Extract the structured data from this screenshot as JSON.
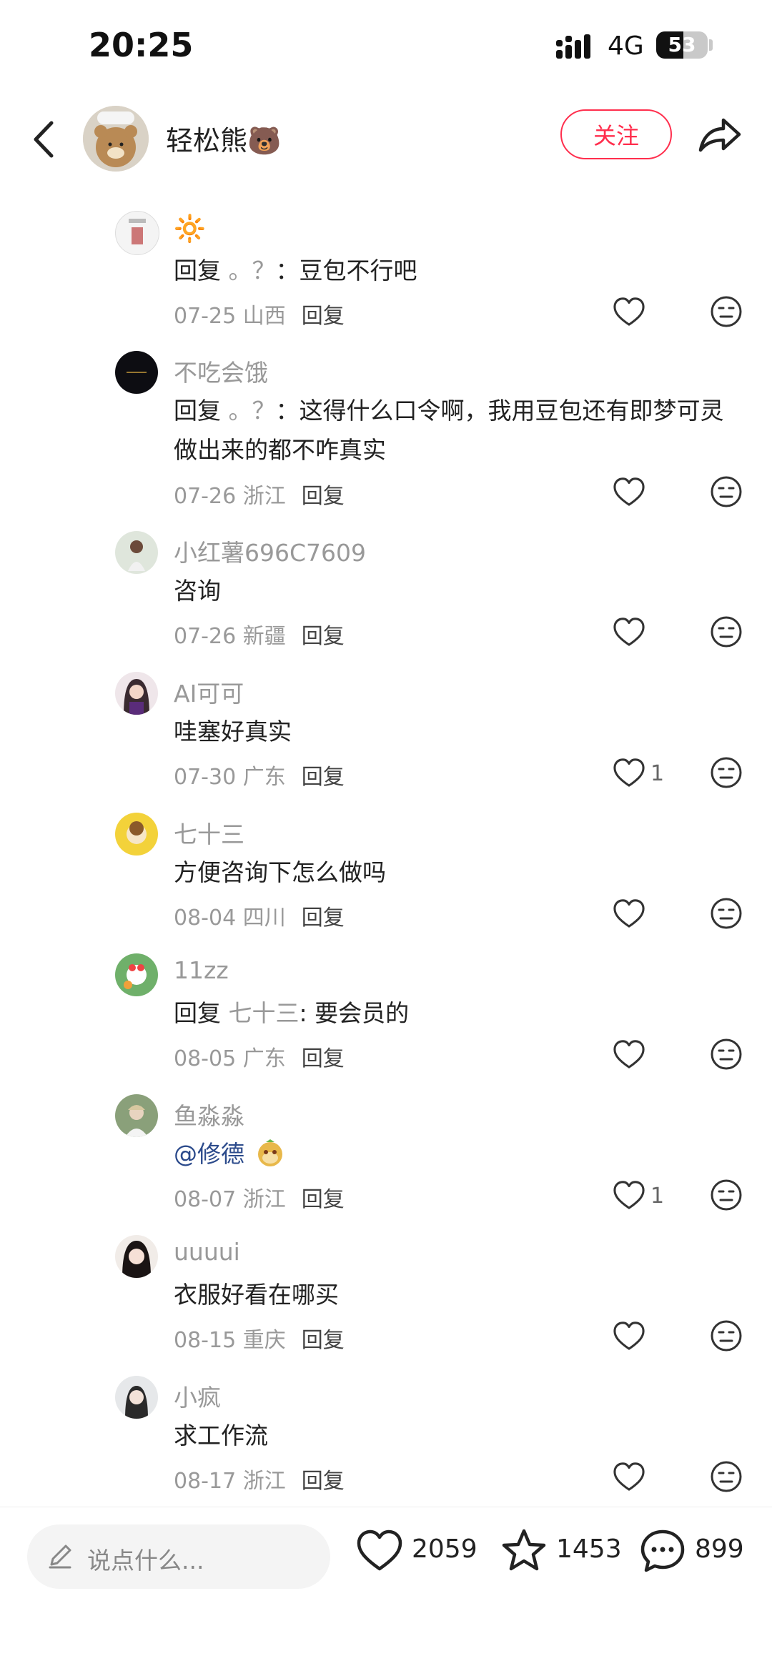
{
  "status_bar": {
    "time": "20:25",
    "network": "4G",
    "battery": "53",
    "battery_level": 0.53
  },
  "header": {
    "author_name": "轻松熊🐻",
    "follow_label": "关注",
    "icons": {
      "back": "back-chevron-icon",
      "share": "share-arrow-icon"
    }
  },
  "comments": [
    {
      "author": "",
      "emoji": "🔆",
      "text_prefix": "回复 ",
      "reply_to": "。？",
      "text_body": "：豆包不行吧",
      "date": "07-25",
      "location": "山西",
      "reply_label": "回复",
      "likes": ""
    },
    {
      "author": "不吃会饿",
      "text_prefix": "回复 ",
      "reply_to": "。？",
      "text_body": "：这得什么口令啊，我用豆包还有即梦可灵做出来的都不咋真实",
      "date": "07-26",
      "location": "浙江",
      "reply_label": "回复",
      "likes": ""
    },
    {
      "author": "小红薯696C7609",
      "text": "咨询",
      "date": "07-26",
      "location": "新疆",
      "reply_label": "回复",
      "likes": ""
    },
    {
      "author": "AI可可",
      "text": "哇塞好真实",
      "date": "07-30",
      "location": "广东",
      "reply_label": "回复",
      "likes": "1"
    },
    {
      "author": "七十三",
      "text": "方便咨询下怎么做吗",
      "date": "08-04",
      "location": "四川",
      "reply_label": "回复",
      "likes": ""
    },
    {
      "author": "11zz",
      "text_prefix": "回复 ",
      "reply_to": "七十三",
      "text_body": ": 要会员的",
      "date": "08-05",
      "location": "广东",
      "reply_label": "回复",
      "likes": ""
    },
    {
      "author": "鱼淼淼",
      "mention": "@修德",
      "emoji": "🐵",
      "date": "08-07",
      "location": "浙江",
      "reply_label": "回复",
      "likes": "1"
    },
    {
      "author": "uuuui",
      "text": "衣服好看在哪买",
      "date": "08-15",
      "location": "重庆",
      "reply_label": "回复",
      "likes": ""
    },
    {
      "author": "小疯",
      "text": "求工作流",
      "date": "08-17",
      "location": "浙江",
      "reply_label": "回复",
      "likes": ""
    }
  ],
  "bottom_bar": {
    "input_placeholder": "说点什么...",
    "likes": "2059",
    "collects": "1453",
    "comments": "899",
    "icons": {
      "pen": "pen-icon",
      "like": "heart-icon",
      "collect": "star-icon",
      "comment": "comment-bubble-icon"
    }
  },
  "colors": {
    "accent": "#ff2e4d",
    "secondary_text": "#999999",
    "mention": "#2b4a8b"
  }
}
